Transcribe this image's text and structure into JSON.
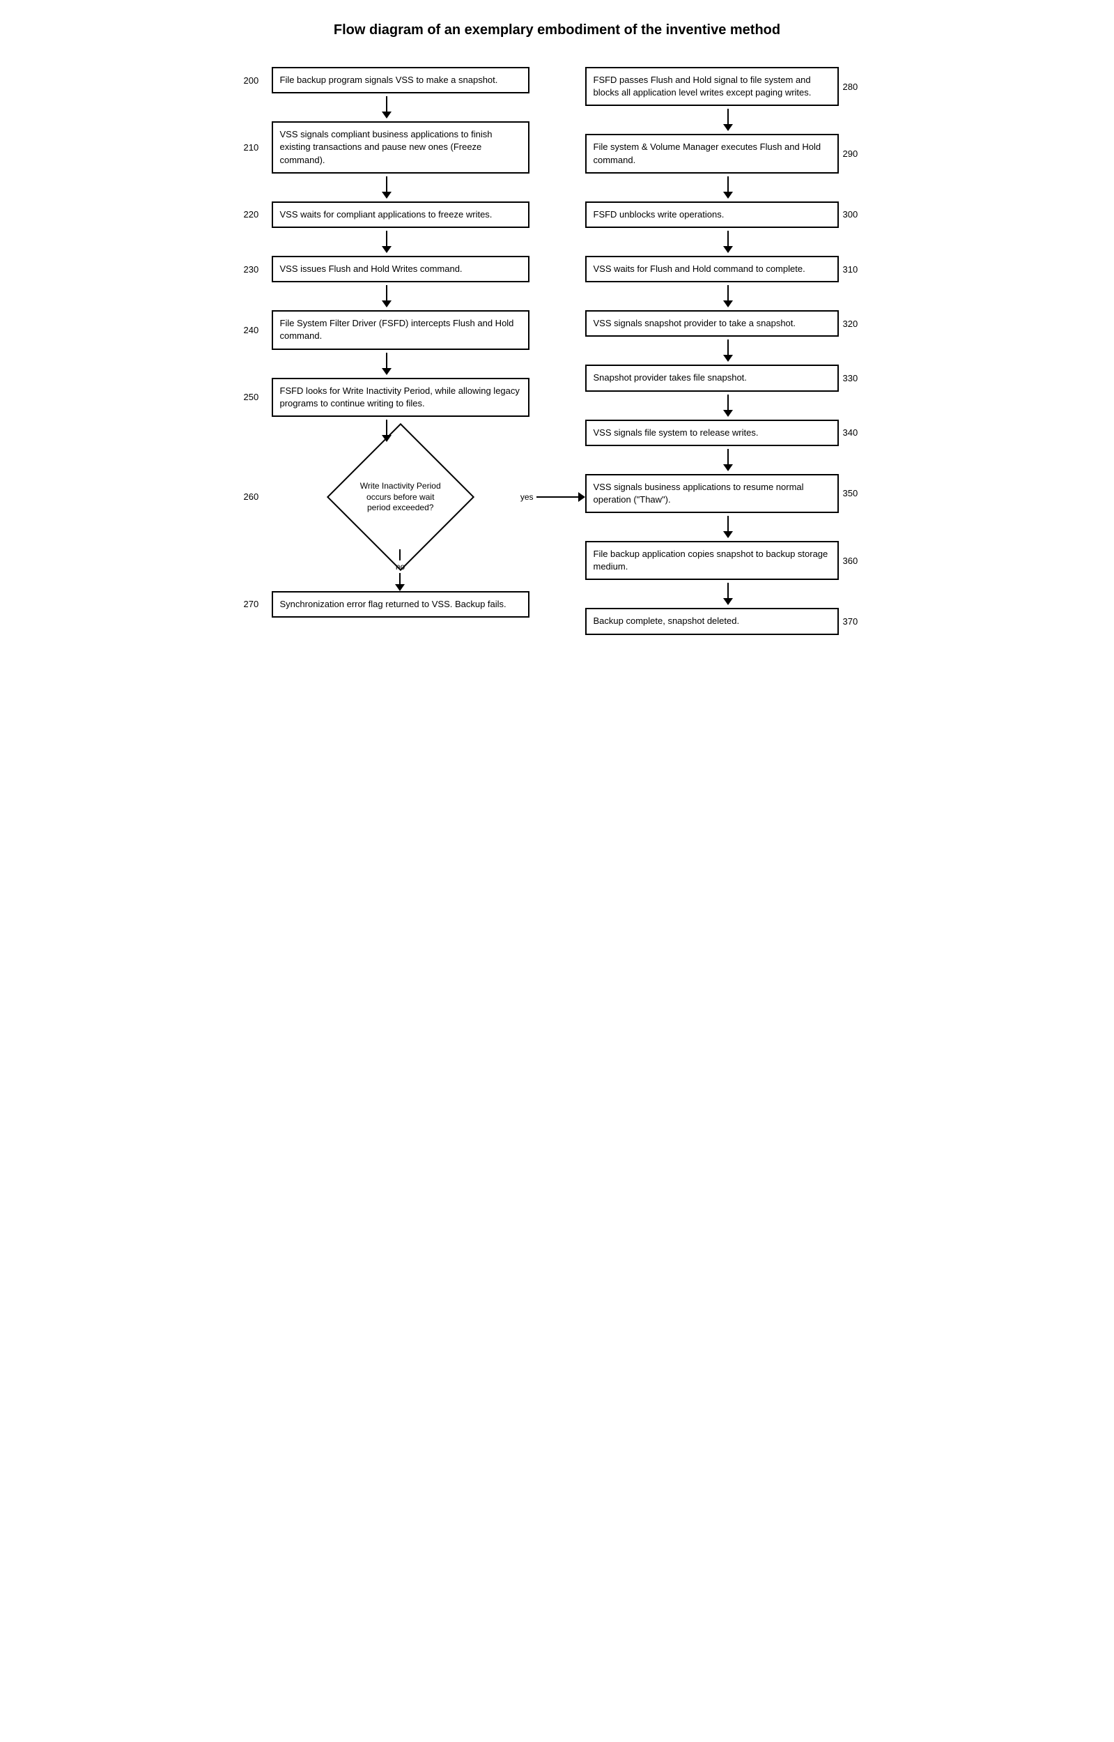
{
  "title": "Flow diagram of an exemplary embodiment of the inventive method",
  "left_column": [
    {
      "id": "200",
      "text": "File backup program signals VSS to make a snapshot."
    },
    {
      "id": "210",
      "text": "VSS signals compliant business applications to finish existing transactions and pause new ones (Freeze command)."
    },
    {
      "id": "220",
      "text": "VSS waits for compliant applications to freeze writes."
    },
    {
      "id": "230",
      "text": "VSS issues Flush and Hold Writes command."
    },
    {
      "id": "240",
      "text": "File System Filter Driver (FSFD) intercepts Flush and Hold command."
    },
    {
      "id": "250",
      "text": "FSFD looks for Write Inactivity Period, while allowing legacy programs to continue writing to files."
    }
  ],
  "diamond": {
    "id": "260",
    "text": "Write Inactivity Period occurs before wait period exceeded?",
    "yes_label": "yes",
    "no_label": "no"
  },
  "step_270": {
    "id": "270",
    "text": "Synchronization error flag returned to VSS. Backup fails."
  },
  "right_column": [
    {
      "id": "280",
      "text": "FSFD passes Flush and Hold signal to file system and blocks all application level writes except paging writes."
    },
    {
      "id": "290",
      "text": "File system & Volume Manager executes Flush and Hold command."
    },
    {
      "id": "300",
      "text": "FSFD unblocks write operations."
    },
    {
      "id": "310",
      "text": "VSS waits for Flush and Hold command to complete."
    },
    {
      "id": "320",
      "text": "VSS signals snapshot provider to take a snapshot."
    },
    {
      "id": "330",
      "text": "Snapshot provider takes file snapshot."
    },
    {
      "id": "340",
      "text": "VSS signals file system to release writes."
    },
    {
      "id": "350",
      "text": "VSS signals business applications to resume normal operation (\"Thaw\")."
    },
    {
      "id": "360",
      "text": "File backup application copies snapshot to backup storage medium."
    },
    {
      "id": "370",
      "text": "Backup complete, snapshot deleted."
    }
  ]
}
